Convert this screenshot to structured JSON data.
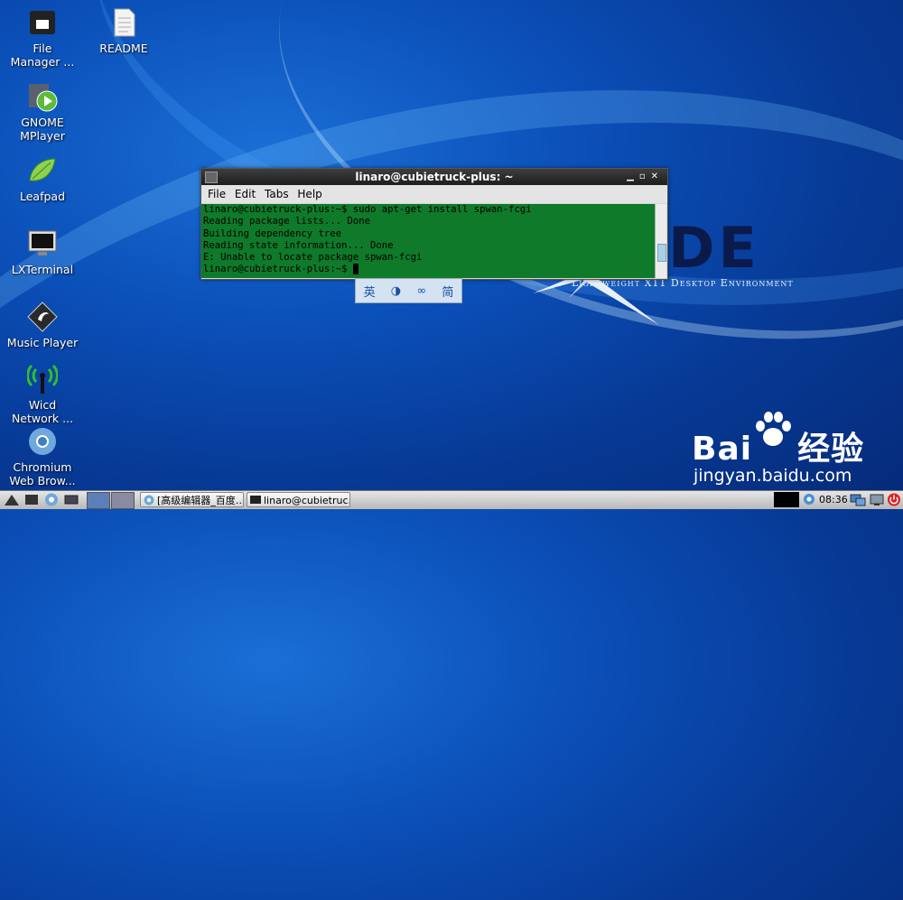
{
  "desktop": {
    "icons": [
      {
        "label": "File\nManager ...",
        "icon": "file-manager-icon"
      },
      {
        "label": "README",
        "icon": "text-document-icon"
      },
      {
        "label": "GNOME\nMPlayer",
        "icon": "media-player-icon"
      },
      {
        "label": "Leafpad",
        "icon": "leafpad-icon"
      },
      {
        "label": "LXTerminal",
        "icon": "terminal-icon"
      },
      {
        "label": "Music Player",
        "icon": "music-player-icon"
      },
      {
        "label": "Wicd\nNetwork ...",
        "icon": "wicd-network-icon"
      },
      {
        "label": "Chromium\nWeb Brow...",
        "icon": "chromium-icon"
      }
    ],
    "wallpaper": {
      "logo_text": "DE",
      "tagline": "Lightweight X11 Desktop Environment"
    }
  },
  "terminal": {
    "title": "linaro@cubietruck-plus: ~",
    "menu": [
      "File",
      "Edit",
      "Tabs",
      "Help"
    ],
    "lines": [
      "linaro@cubietruck-plus:~$ sudo apt-get install spwan-fcgi",
      "Reading package lists... Done",
      "Building dependency tree",
      "Reading state information... Done",
      "E: Unable to locate package spwan-fcgi",
      "linaro@cubietruck-plus:~$ "
    ],
    "bg_color": "#0e7a2a"
  },
  "ime_bar": {
    "items": [
      "英",
      "◑",
      "∞",
      "简"
    ]
  },
  "watermark": {
    "brand_left": "Bai",
    "brand_right": "经验",
    "url": "jingyan.baidu.com"
  },
  "taskbar": {
    "tasks": [
      {
        "label": "[高级编辑器_百度…",
        "icon": "chromium-icon"
      },
      {
        "label": "linaro@cubietruc…",
        "icon": "terminal-icon"
      }
    ],
    "clock": "08:36"
  }
}
